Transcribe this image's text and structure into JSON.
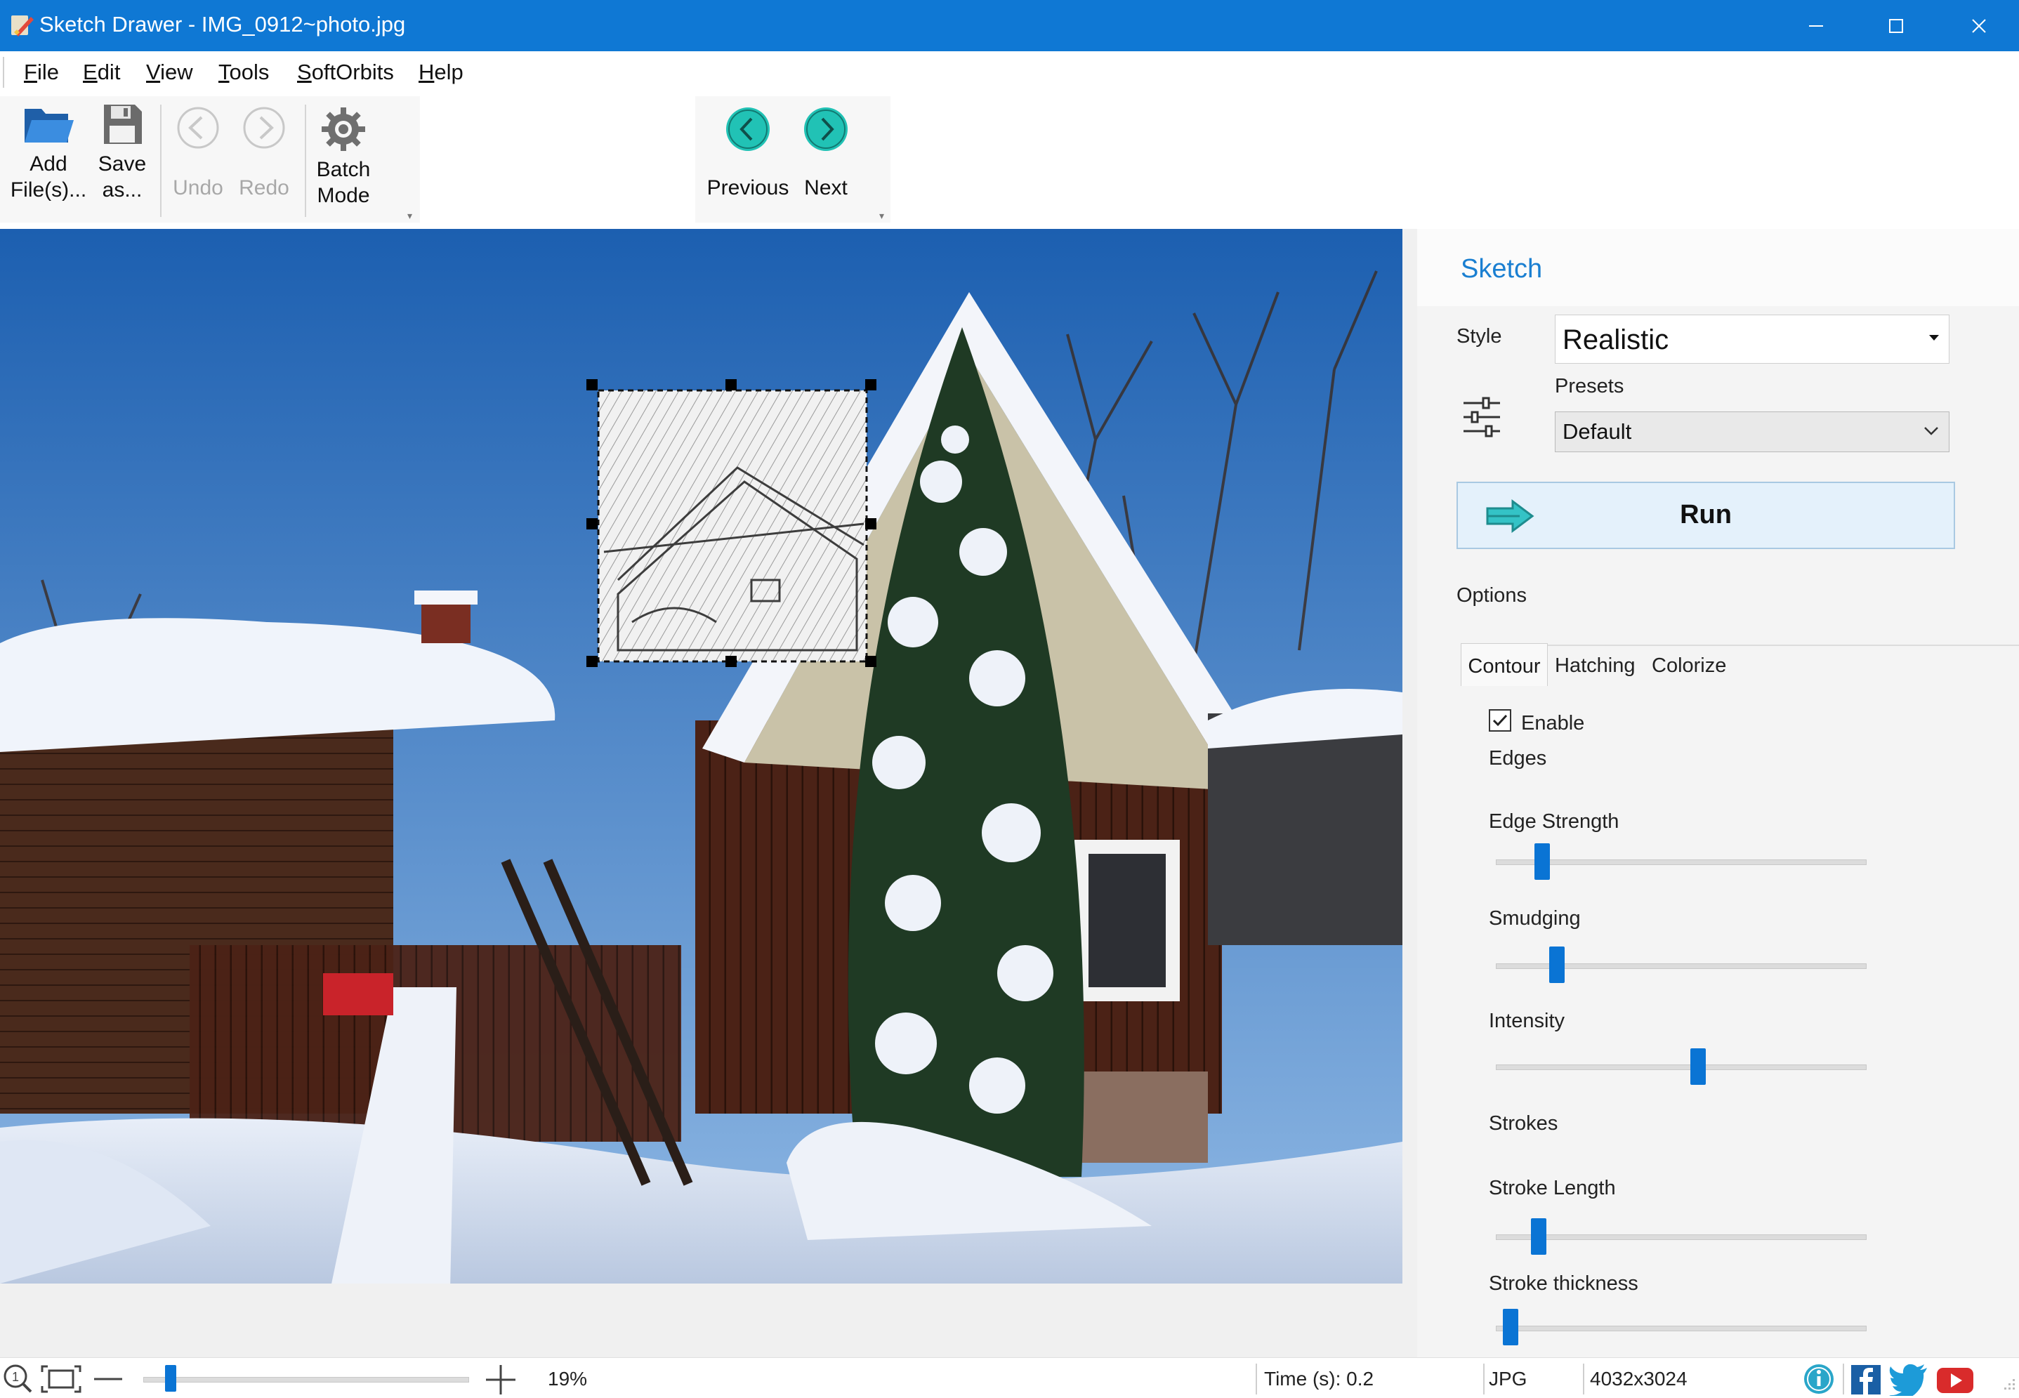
{
  "window": {
    "title": "Sketch Drawer - IMG_0912~photo.jpg",
    "icon": "sketch-drawer-app-icon",
    "accent_color": "#0f78d4"
  },
  "menu": [
    "File",
    "Edit",
    "View",
    "Tools",
    "SoftOrbits",
    "Help"
  ],
  "toolbar": {
    "add_files_line1": "Add",
    "add_files_line2": "File(s)...",
    "save_line1": "Save",
    "save_line2": "as...",
    "undo": "Undo",
    "redo": "Redo",
    "batch_line1": "Batch",
    "batch_line2": "Mode",
    "previous": "Previous",
    "next": "Next"
  },
  "panel": {
    "title": "Sketch",
    "style_label": "Style",
    "style_value": "Realistic",
    "presets_label": "Presets",
    "presets_value": "Default",
    "run_label": "Run",
    "options_label": "Options",
    "tabs": [
      "Contour",
      "Hatching",
      "Colorize"
    ],
    "active_tab": "Contour",
    "enable_label": "Enable",
    "enable_checked": true,
    "edges_heading": "Edges",
    "strokes_heading": "Strokes",
    "sliders": {
      "edge_strength": {
        "label": "Edge Strength",
        "value": 0.11
      },
      "smudging": {
        "label": "Smudging",
        "value": 0.15
      },
      "intensity": {
        "label": "Intensity",
        "value": 0.55
      },
      "stroke_length": {
        "label": "Stroke Length",
        "value": 0.1
      },
      "stroke_thickness": {
        "label": "Stroke thickness",
        "value": 0.02
      }
    }
  },
  "status": {
    "zoom": "19%",
    "zoom_level": 0.07,
    "time": "Time (s): 0.2",
    "format": "JPG",
    "dimensions": "4032x3024"
  }
}
